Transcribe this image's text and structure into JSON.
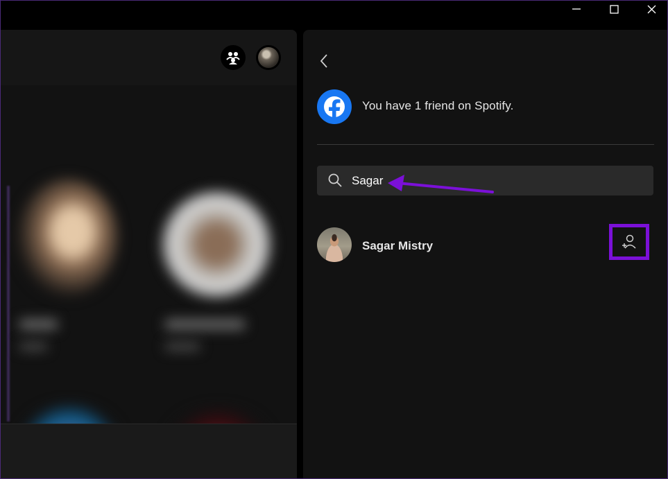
{
  "window_controls": {
    "minimize_icon": "minimize-icon",
    "maximize_icon": "maximize-icon",
    "close_icon": "close-icon"
  },
  "top_bar": {
    "friends_icon": "friend-activity-icon",
    "profile_icon": "profile-avatar"
  },
  "friend_panel": {
    "back_icon": "chevron-left-icon",
    "facebook_icon": "facebook-icon",
    "friend_count_text": "You have 1 friend on Spotify.",
    "search": {
      "icon": "search-icon",
      "value": "Sagar"
    },
    "results": [
      {
        "name": "Sagar Mistry",
        "action_icon": "add-user-icon"
      }
    ]
  },
  "colors": {
    "background": "#121212",
    "facebook_blue": "#1877f2",
    "highlight_purple": "#7b10d8",
    "search_bg": "#2a2a2a"
  }
}
